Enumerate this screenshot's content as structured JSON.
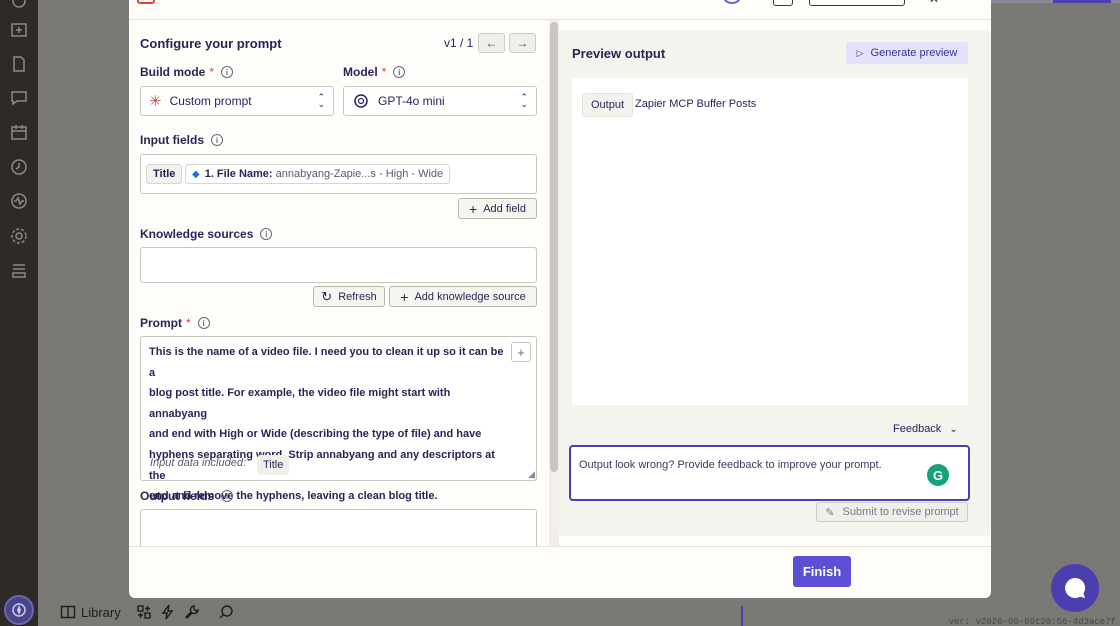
{
  "config": {
    "title": "Configure your prompt",
    "version": "v1 / 1",
    "build_mode_label": "Build mode",
    "build_mode_value": "Custom prompt",
    "model_label": "Model",
    "model_value": "GPT-4o mini",
    "required_mark": "*",
    "input_fields_label": "Input fields",
    "input_chip_title": "Title",
    "input_chip_step": "1. File Name:",
    "input_chip_value": "annabyang-Zapie...s - High - Wide",
    "add_field_label": "Add field",
    "knowledge_label": "Knowledge sources",
    "refresh_label": "Refresh",
    "add_knowledge_label": "Add knowledge source",
    "prompt_label": "Prompt",
    "prompt_lines": [
      "This is the name of a video file. I need you to clean it up so it can be a",
      "blog post title. For example, the video file might start with annabyang",
      "and end with High or Wide (describing the type of file) and have",
      "hyphens separating word. Strip annabyang and any descriptors at the",
      "end and remove the hyphens, leaving a clean blog title."
    ],
    "input_data_label": "Input data included:",
    "input_data_chip": "Title",
    "output_fields_label": "Output fields"
  },
  "preview": {
    "title": "Preview output",
    "generate_label": "Generate preview",
    "output_tag": "Output",
    "output_value": "Zapier MCP Buffer Posts",
    "feedback_label": "Feedback",
    "feedback_placeholder": "Output look wrong? Provide feedback to improve your prompt.",
    "submit_label": "Submit to revise prompt"
  },
  "footer": {
    "finish_label": "Finish"
  },
  "bottombar": {
    "library_label": "Library",
    "version_text": "ver: v2026-06-09t20:56-4d3ace7f"
  },
  "colors": {
    "accent": "#5b4fd6",
    "sidebar": "#2d2a27",
    "overlay": "#7a7975"
  }
}
